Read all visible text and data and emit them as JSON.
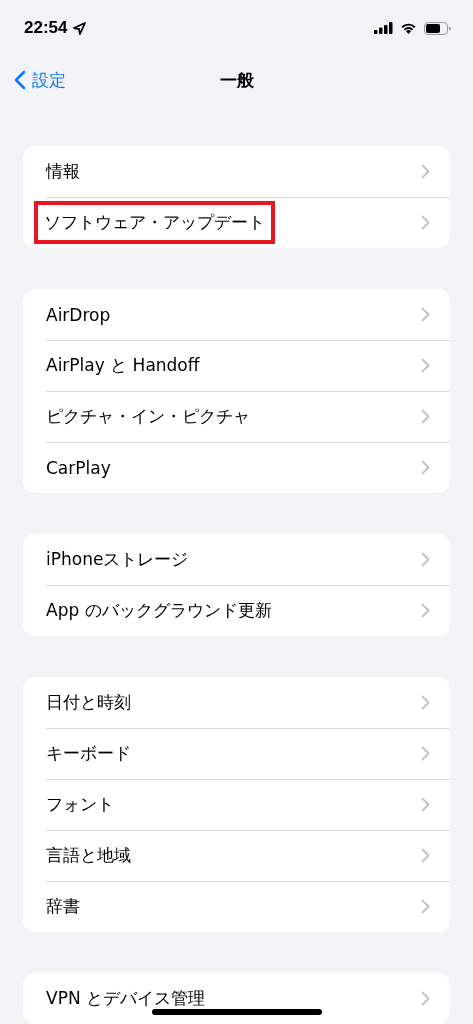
{
  "status_bar": {
    "time": "22:54"
  },
  "nav": {
    "back_label": "設定",
    "title": "一般"
  },
  "groups": [
    {
      "rows": [
        {
          "label": "情報",
          "highlighted": false
        },
        {
          "label": "ソフトウェア・アップデート",
          "highlighted": true
        }
      ]
    },
    {
      "rows": [
        {
          "label": "AirDrop",
          "highlighted": false
        },
        {
          "label": "AirPlay と Handoff",
          "highlighted": false
        },
        {
          "label": "ピクチャ・イン・ピクチャ",
          "highlighted": false
        },
        {
          "label": "CarPlay",
          "highlighted": false
        }
      ]
    },
    {
      "rows": [
        {
          "label": "iPhoneストレージ",
          "highlighted": false
        },
        {
          "label": "App のバックグラウンド更新",
          "highlighted": false
        }
      ]
    },
    {
      "rows": [
        {
          "label": "日付と時刻",
          "highlighted": false
        },
        {
          "label": "キーボード",
          "highlighted": false
        },
        {
          "label": "フォント",
          "highlighted": false
        },
        {
          "label": "言語と地域",
          "highlighted": false
        },
        {
          "label": "辞書",
          "highlighted": false
        }
      ]
    },
    {
      "rows": [
        {
          "label": "VPN とデバイス管理",
          "highlighted": false
        }
      ]
    }
  ]
}
